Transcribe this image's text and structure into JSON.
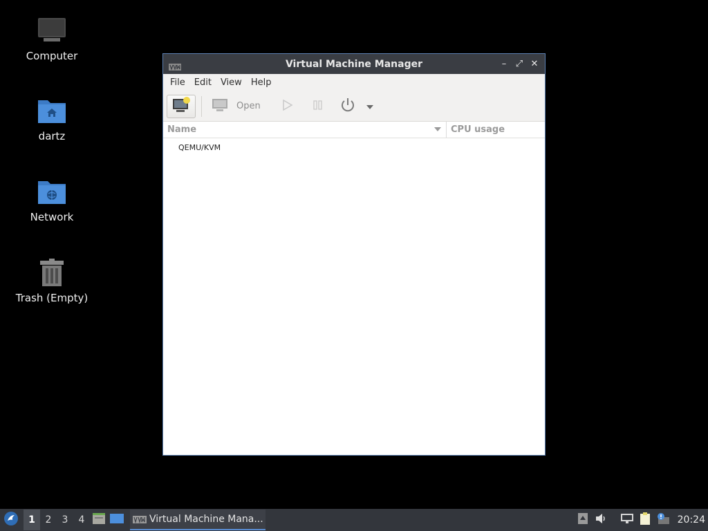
{
  "desktop": {
    "icons": [
      {
        "label": "Computer"
      },
      {
        "label": "dartz"
      },
      {
        "label": "Network"
      },
      {
        "label": "Trash (Empty)"
      }
    ]
  },
  "window": {
    "title": "Virtual Machine Manager",
    "controls": {
      "minimize": "–",
      "maximize": "⤢",
      "close": "✕"
    },
    "menu": [
      "File",
      "Edit",
      "View",
      "Help"
    ],
    "toolbar": {
      "open_label": "Open"
    },
    "list": {
      "headers": {
        "name": "Name",
        "cpu": "CPU usage"
      },
      "rows": [
        {
          "name": "QEMU/KVM"
        }
      ]
    }
  },
  "taskbar": {
    "workspaces": [
      "1",
      "2",
      "3",
      "4"
    ],
    "active_workspace": "1",
    "task_label": "Virtual Machine Mana...",
    "clock": "20:24",
    "accent": "#5b8fd6"
  }
}
